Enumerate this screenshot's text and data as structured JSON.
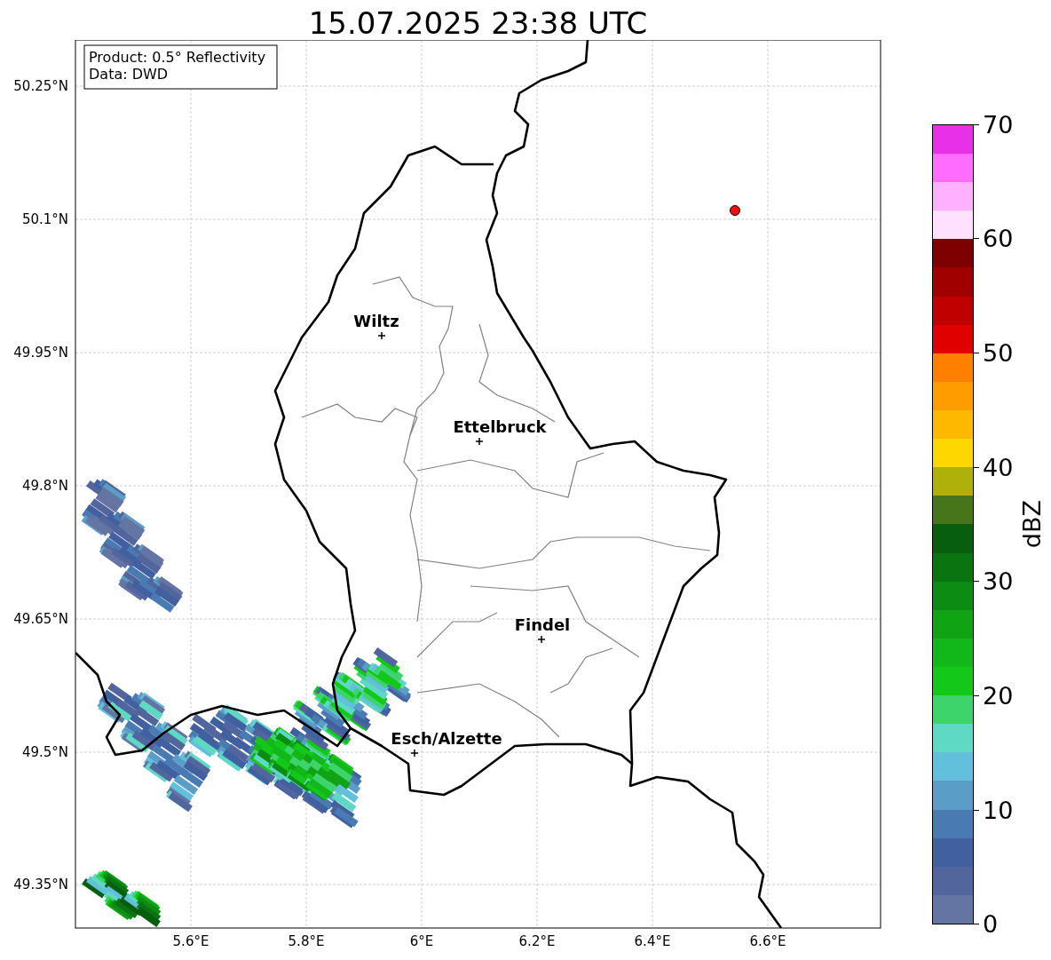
{
  "title": "15.07.2025 23:38 UTC",
  "info_box": {
    "lines": [
      "Product: 0.5° Reflectivity",
      "Data: DWD"
    ]
  },
  "map": {
    "latitude_labels": [
      "50.25°N",
      "50.1°N",
      "49.95°N",
      "49.8°N",
      "49.65°N",
      "49.5°N",
      "49.35°N"
    ],
    "longitude_labels": [
      "5.6°E",
      "5.8°E",
      "6°E",
      "6.2°E",
      "6.4°E",
      "6.6°E"
    ],
    "cities": [
      {
        "name": "Wiltz"
      },
      {
        "name": "Ettelbruck"
      },
      {
        "name": "Findel"
      },
      {
        "name": "Esch/Alzette"
      }
    ]
  },
  "colorbar": {
    "label": "dBZ",
    "ticks": [
      "70",
      "60",
      "50",
      "40",
      "30",
      "20",
      "10",
      "0"
    ],
    "segments": [
      {
        "color": "#6475a3"
      },
      {
        "color": "#52659c"
      },
      {
        "color": "#4160a0"
      },
      {
        "color": "#4a7ab2"
      },
      {
        "color": "#5a9ec8"
      },
      {
        "color": "#63c0dc"
      },
      {
        "color": "#5fd8c4"
      },
      {
        "color": "#3dd46c"
      },
      {
        "color": "#14c81a"
      },
      {
        "color": "#12b81a"
      },
      {
        "color": "#10a414"
      },
      {
        "color": "#0d8c14"
      },
      {
        "color": "#0a7410"
      },
      {
        "color": "#065e0e"
      },
      {
        "color": "#47761a"
      },
      {
        "color": "#b0b00a"
      },
      {
        "color": "#ffd700"
      },
      {
        "color": "#ffb800"
      },
      {
        "color": "#ff9c00"
      },
      {
        "color": "#ff7f00"
      },
      {
        "color": "#e00000"
      },
      {
        "color": "#c00000"
      },
      {
        "color": "#a00000"
      },
      {
        "color": "#7e0000"
      },
      {
        "color": "#ffe0ff"
      },
      {
        "color": "#ffb0ff"
      },
      {
        "color": "#ff6cff"
      },
      {
        "color": "#e830e8"
      }
    ]
  }
}
